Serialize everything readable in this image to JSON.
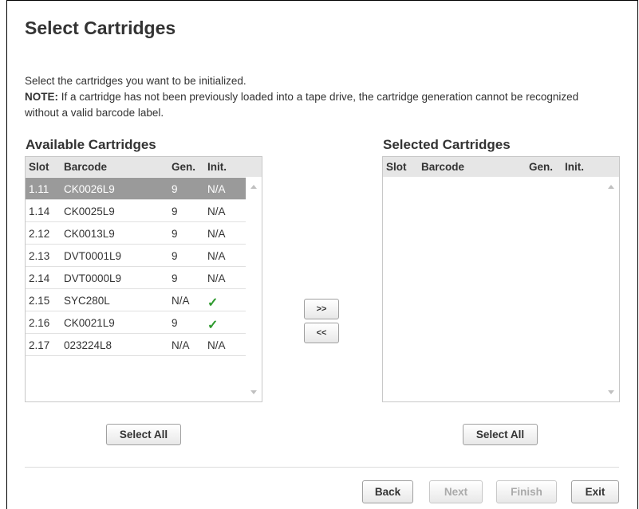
{
  "page": {
    "title": "Select Cartridges",
    "instruction": "Select the cartridges you want to be initialized.",
    "note_label": "NOTE:",
    "note_text": " If a cartridge has not been previously loaded into a tape drive, the cartridge generation cannot be recognized without a valid barcode label."
  },
  "available": {
    "title": "Available Cartridges",
    "columns": {
      "slot": "Slot",
      "barcode": "Barcode",
      "gen": "Gen.",
      "init": "Init."
    },
    "rows": [
      {
        "slot": "1.11",
        "barcode": "CK0026L9",
        "gen": "9",
        "init": "N/A",
        "selected": true
      },
      {
        "slot": "1.14",
        "barcode": "CK0025L9",
        "gen": "9",
        "init": "N/A"
      },
      {
        "slot": "2.12",
        "barcode": "CK0013L9",
        "gen": "9",
        "init": "N/A"
      },
      {
        "slot": "2.13",
        "barcode": "DVT0001L9",
        "gen": "9",
        "init": "N/A"
      },
      {
        "slot": "2.14",
        "barcode": "DVT0000L9",
        "gen": "9",
        "init": "N/A"
      },
      {
        "slot": "2.15",
        "barcode": "SYC280L",
        "gen": "N/A",
        "init": "✓"
      },
      {
        "slot": "2.16",
        "barcode": "CK0021L9",
        "gen": "9",
        "init": "✓"
      },
      {
        "slot": "2.17",
        "barcode": "023224L8",
        "gen": "N/A",
        "init": "N/A"
      }
    ],
    "select_all": "Select All"
  },
  "selected": {
    "title": "Selected Cartridges",
    "columns": {
      "slot": "Slot",
      "barcode": "Barcode",
      "gen": "Gen.",
      "init": "Init."
    },
    "rows": [],
    "select_all": "Select All"
  },
  "transfer": {
    "add": ">>",
    "remove": "<<"
  },
  "footer": {
    "back": "Back",
    "next": "Next",
    "finish": "Finish",
    "exit": "Exit"
  },
  "colors": {
    "selected_row": "#9a9a9a",
    "check": "#2e9a2e",
    "header_bg": "#e6e6e6"
  },
  "icons": {
    "init_check": "check-icon",
    "scroll_up": "scroll-up-icon",
    "scroll_down": "scroll-down-icon"
  }
}
